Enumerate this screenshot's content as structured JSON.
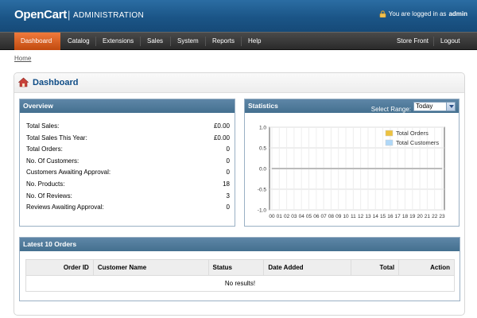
{
  "header": {
    "logo": "OpenCart",
    "separator": "|",
    "title": "ADMINISTRATION",
    "login_text": "You are logged in as",
    "username": "admin"
  },
  "menu": {
    "items": [
      "Dashboard",
      "Catalog",
      "Extensions",
      "Sales",
      "System",
      "Reports",
      "Help"
    ],
    "right_items": [
      "Store Front",
      "Logout"
    ],
    "active": "Dashboard"
  },
  "breadcrumb": "Home",
  "page_title": "Dashboard",
  "overview": {
    "title": "Overview",
    "rows": [
      {
        "label": "Total Sales:",
        "value": "£0.00"
      },
      {
        "label": "Total Sales This Year:",
        "value": "£0.00"
      },
      {
        "label": "Total Orders:",
        "value": "0"
      },
      {
        "label": "No. Of Customers:",
        "value": "0"
      },
      {
        "label": "Customers Awaiting Approval:",
        "value": "0"
      },
      {
        "label": "No. Products:",
        "value": "18"
      },
      {
        "label": "No. Of Reviews:",
        "value": "3"
      },
      {
        "label": "Reviews Awaiting Approval:",
        "value": "0"
      }
    ]
  },
  "statistics": {
    "title": "Statistics",
    "range_label": "Select Range:",
    "range_value": "Today"
  },
  "chart_data": {
    "type": "line",
    "x": [
      "00",
      "01",
      "02",
      "03",
      "04",
      "05",
      "06",
      "07",
      "08",
      "09",
      "10",
      "11",
      "12",
      "13",
      "14",
      "15",
      "16",
      "17",
      "18",
      "19",
      "20",
      "21",
      "22",
      "23"
    ],
    "series": [
      {
        "name": "Total Orders",
        "color": "#edc240",
        "values": [
          0,
          0,
          0,
          0,
          0,
          0,
          0,
          0,
          0,
          0,
          0,
          0,
          0,
          0,
          0,
          0,
          0,
          0,
          0,
          0,
          0,
          0,
          0,
          0
        ]
      },
      {
        "name": "Total Customers",
        "color": "#afd8f8",
        "values": [
          0,
          0,
          0,
          0,
          0,
          0,
          0,
          0,
          0,
          0,
          0,
          0,
          0,
          0,
          0,
          0,
          0,
          0,
          0,
          0,
          0,
          0,
          0,
          0
        ]
      }
    ],
    "yticks": [
      "1.0",
      "0.5",
      "0.0",
      "-0.5",
      "-1.0"
    ],
    "ylim": [
      -1.0,
      1.0
    ],
    "legend": "top-right"
  },
  "latest_orders": {
    "title": "Latest 10 Orders",
    "columns": [
      "Order ID",
      "Customer Name",
      "Status",
      "Date Added",
      "Total",
      "Action"
    ],
    "empty_text": "No results!"
  },
  "colors": {
    "header_blue": "#1b5587",
    "menu_active": "#e06a2a",
    "panel_head": "#52809f",
    "title_blue": "#0e4c86"
  }
}
